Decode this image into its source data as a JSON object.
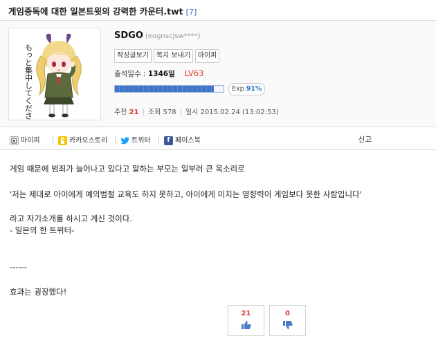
{
  "post": {
    "title": "게임중독에 대한 일본트윗의 강력한 카운터.twt",
    "comment_count": "[7]"
  },
  "author": {
    "nickname": "SDGO",
    "user_id": "(eognscjsw****)",
    "buttons": [
      "작성글보기",
      "쪽지 보내기",
      "마이피"
    ],
    "attendance_label": "출석일수 : ",
    "attendance_value": "1346일",
    "level": "LV63",
    "exp_label": "Exp.",
    "exp_value": "91%",
    "exp_progress": 0.91,
    "avatar_caption": "もっと集中してください"
  },
  "meta": {
    "recommend_label": "추천",
    "recommend_value": "21",
    "views_label": "조회",
    "views_value": "578",
    "date_label": "일시",
    "date_value": "2015.02.24 (13:02:53)"
  },
  "share": {
    "items": [
      "마이피",
      "카카오스토리",
      "트위터",
      "페이스북"
    ],
    "report": "신고"
  },
  "content": {
    "lines": [
      "게임 때문에 범죄가 늘어나고 있다고 말하는 부모는 일부러 큰 목소리로",
      "'저는 제대로 아이에게 예의범절 교육도 하지 못하고, 아이에게 미치는 영향력이 게임보다 못한 사람입니다'",
      "라고 자기소개를 하시고 계신 것이다.",
      "   - 일본의 한 트위터-",
      "------",
      "효과는 굉장했다!"
    ]
  },
  "votes": {
    "up": "21",
    "down": "0"
  },
  "colors": {
    "accent_red": "#e03a2e",
    "accent_blue": "#2d6fb7",
    "twitter": "#1da1f2",
    "facebook": "#3b5998",
    "kakao": "#f7c400"
  }
}
